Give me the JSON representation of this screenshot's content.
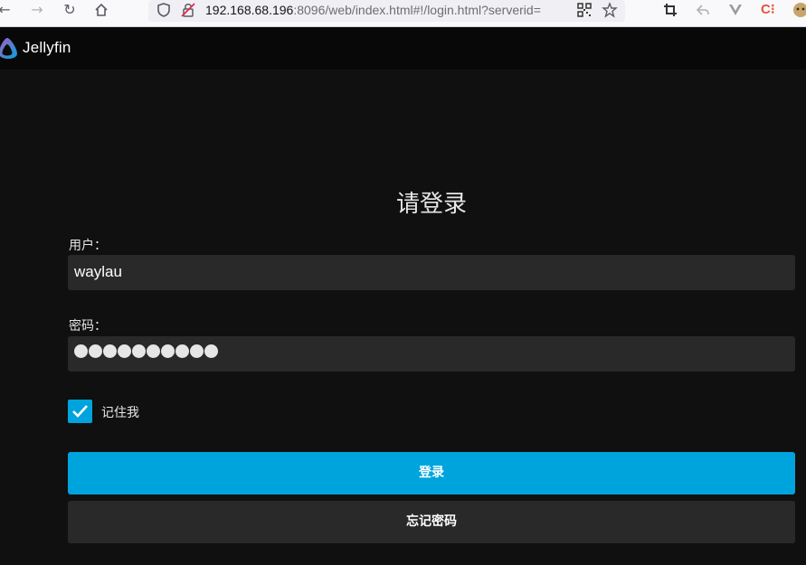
{
  "browser": {
    "url_host": "192.168.68.196",
    "url_rest": ":8096/web/index.html#!/login.html?serverid=",
    "back_icon": "arrow-left-icon",
    "forward_icon": "arrow-right-icon",
    "reload_icon": "reload-icon",
    "home_icon": "home-icon"
  },
  "app": {
    "name": "Jellyfin",
    "accent_color": "#00a4dc"
  },
  "login": {
    "title": "请登录",
    "username_label": "用户：",
    "username_value": "waylau",
    "password_label": "密码：",
    "password_length": 10,
    "remember_label": "记住我",
    "remember_checked": true,
    "submit_label": "登录",
    "forgot_label": "忘记密码"
  }
}
